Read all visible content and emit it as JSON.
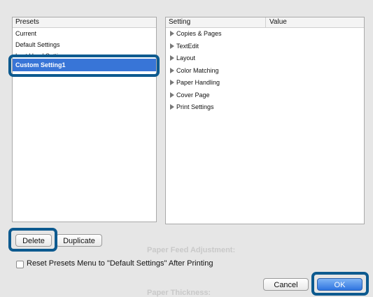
{
  "presets": {
    "header": "Presets",
    "items": [
      {
        "label": "Current"
      },
      {
        "label": "Default Settings"
      },
      {
        "label": "Last Used Settings"
      },
      {
        "label": "Custom Setting1"
      }
    ]
  },
  "settings": {
    "header_setting": "Setting",
    "header_value": "Value",
    "items": [
      {
        "label": "Copies & Pages"
      },
      {
        "label": "TextEdit"
      },
      {
        "label": "Layout"
      },
      {
        "label": "Color Matching"
      },
      {
        "label": "Paper Handling"
      },
      {
        "label": "Cover Page"
      },
      {
        "label": "Print Settings"
      }
    ]
  },
  "buttons": {
    "delete": "Delete",
    "duplicate": "Duplicate",
    "cancel": "Cancel",
    "ok": "OK"
  },
  "reset_checkbox": {
    "label": "Reset Presets Menu to \"Default Settings\" After Printing",
    "checked": false
  },
  "background_ghost": {
    "paper_feed": "Paper Feed Adjustment:",
    "paper_thickness": "Paper Thickness:"
  },
  "colors": {
    "selection": "#3875d7",
    "callout": "#0d5a8f",
    "primary_button": "#2f74e0"
  }
}
